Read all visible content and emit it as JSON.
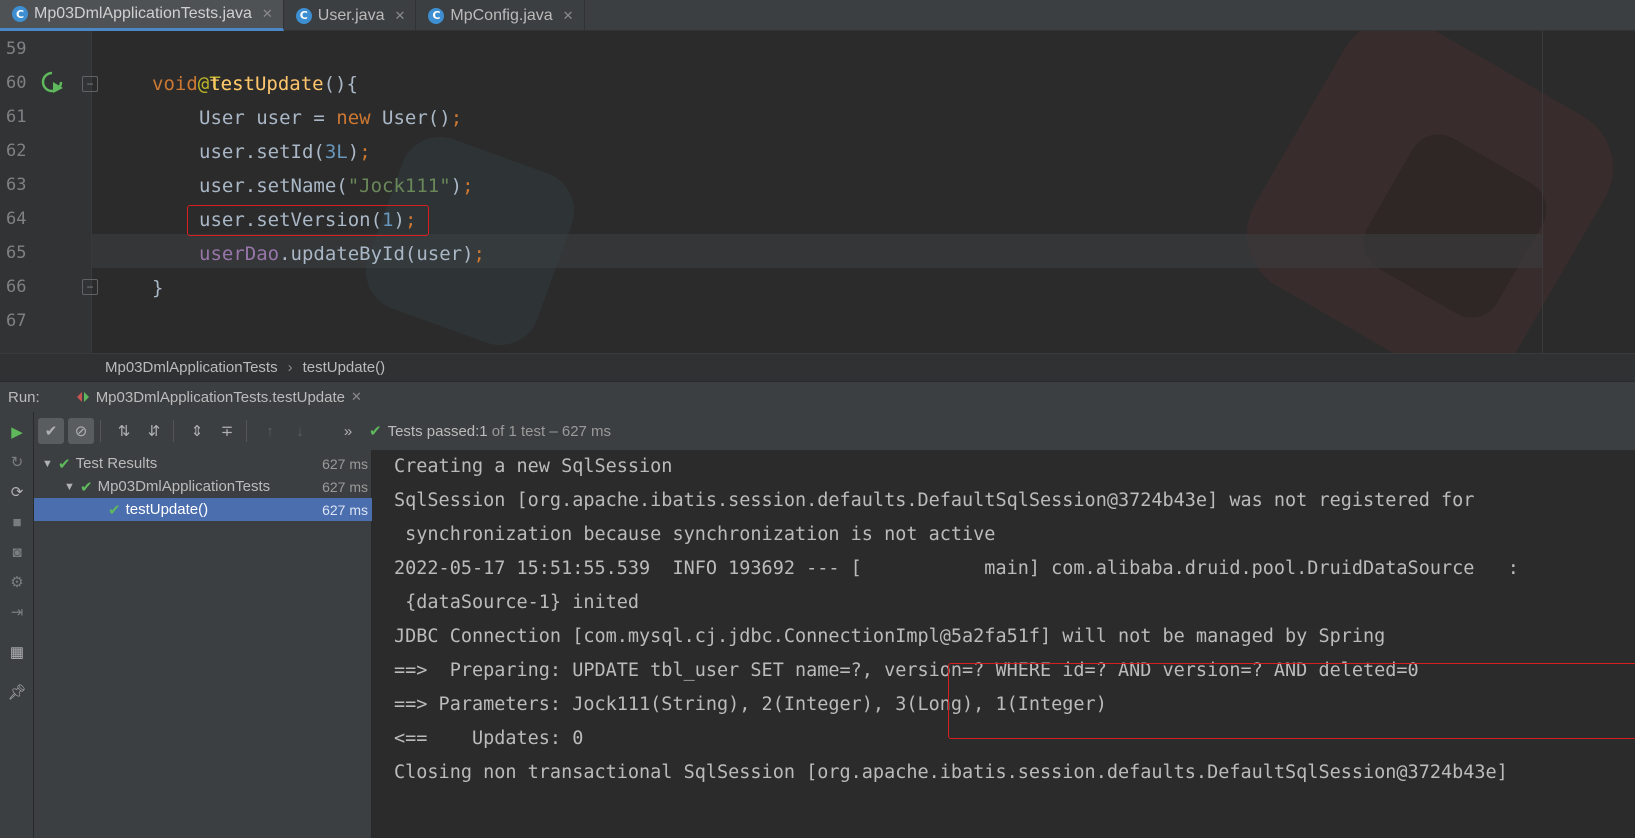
{
  "tabs": [
    {
      "label": "Mp03DmlApplicationTests.java",
      "icon": "class-icon",
      "active": true
    },
    {
      "label": "User.java",
      "icon": "class-icon",
      "active": false
    },
    {
      "label": "MpConfig.java",
      "icon": "class-icon",
      "active": false
    }
  ],
  "editor": {
    "line_numbers": [
      "59",
      "60",
      "61",
      "62",
      "63",
      "64",
      "65",
      "66",
      "67"
    ],
    "lines": {
      "l59_annotation": "@Test",
      "l60_void": "void ",
      "l60_method": "testUpdate",
      "l60_rest": "(){",
      "l61_type": "User user = ",
      "l61_new": "new",
      "l61_rest": " User()",
      "l61_semi": ";",
      "l62_call": "user.setId(",
      "l62_num": "3L",
      "l62_close": ")",
      "l62_semi": ";",
      "l63_call": "user.setName(",
      "l63_str": "\"Jock111\"",
      "l63_close": ")",
      "l63_semi": ";",
      "l64_call": "user.setVersion(",
      "l64_num": "1",
      "l64_close": ")",
      "l64_semi": ";",
      "l65_field": "userDao",
      "l65_call": ".updateById(user)",
      "l65_semi": ";",
      "l66_brace": "}"
    }
  },
  "breadcrumb": {
    "class_name": "Mp03DmlApplicationTests",
    "method_name": "testUpdate()"
  },
  "run_panel": {
    "label": "Run:",
    "tab_label": "Mp03DmlApplicationTests.testUpdate",
    "status_prefix": "Tests passed: ",
    "status_count": "1",
    "status_suffix": " of 1 test – 627 ms"
  },
  "test_tree": [
    {
      "label": "Test Results",
      "time": "627 ms"
    },
    {
      "label": "Mp03DmlApplicationTests",
      "time": "627 ms"
    },
    {
      "label": "testUpdate()",
      "time": "627 ms"
    }
  ],
  "console": [
    "Creating a new SqlSession",
    "SqlSession [org.apache.ibatis.session.defaults.DefaultSqlSession@3724b43e] was not registered for",
    " synchronization because synchronization is not active",
    "2022-05-17 15:51:55.539  INFO 193692 --- [           main] com.alibaba.druid.pool.DruidDataSource   :",
    " {dataSource-1} inited",
    "JDBC Connection [com.mysql.cj.jdbc.ConnectionImpl@5a2fa51f] will not be managed by Spring",
    "==>  Preparing: UPDATE tbl_user SET name=?, version=? WHERE id=? AND version=? AND deleted=0",
    "==> Parameters: Jock111(String), 2(Integer), 3(Long), 1(Integer)",
    "<==    Updates: 0",
    "Closing non transactional SqlSession [org.apache.ibatis.session.defaults.DefaultSqlSession@3724b43e]"
  ],
  "colors": {
    "highlight_box": "#d81f1f",
    "pass_green": "#5fb85c",
    "selection": "#4b6eaf"
  }
}
